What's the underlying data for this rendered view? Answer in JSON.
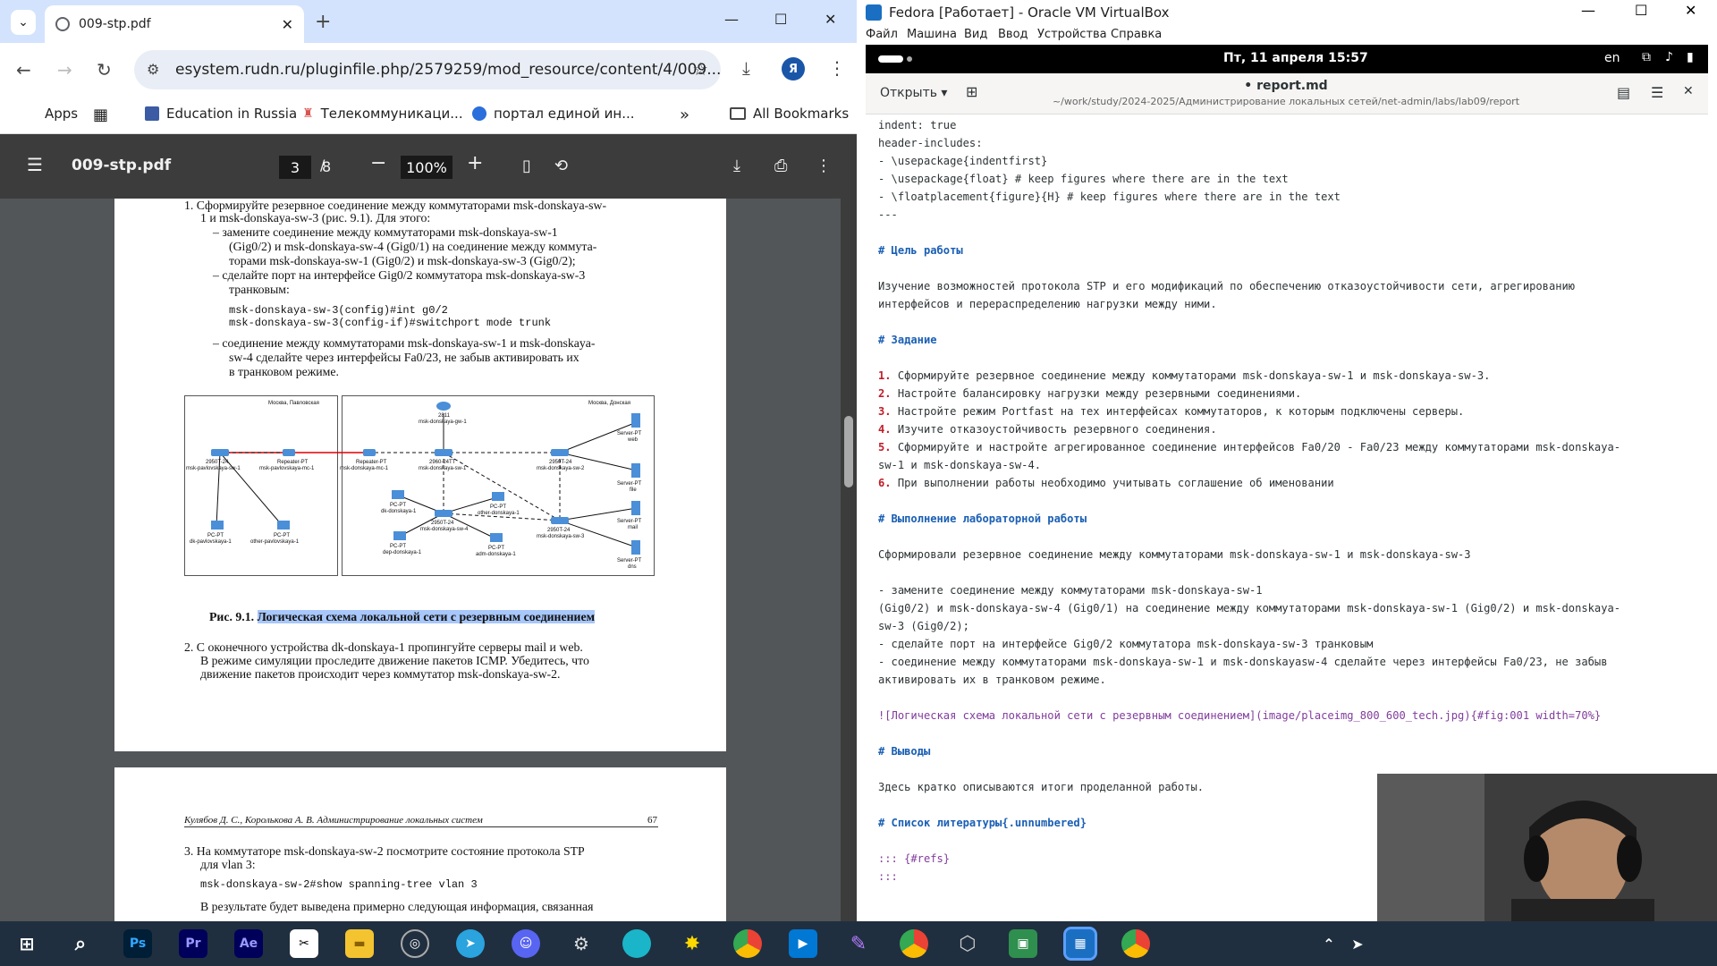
{
  "chrome": {
    "tab_title": "009-stp.pdf",
    "url": "esystem.rudn.ru/pluginfile.php/2579259/mod_resource/content/4/009...",
    "avatar_letter": "Я",
    "bookmarks": [
      "Apps",
      "Education in Russia",
      "Телекоммуникаци...",
      "портал единой ин..."
    ],
    "all_bookmarks": "All Bookmarks",
    "pdf": {
      "filename": "009-stp.pdf",
      "page_current": "3",
      "page_sep": "/",
      "page_total": "8",
      "zoom": "100%"
    }
  },
  "page1": {
    "lines": [
      "1.  Сформируйте резервное соединение между коммутаторами msk-donskaya-sw-",
      "1 и msk-donskaya-sw-3 (рис. 9.1). Для этого:",
      "–  замените соединение между коммутаторами msk-donskaya-sw-1",
      "(Gig0/2) и msk-donskaya-sw-4 (Gig0/1) на соединение между коммута-",
      "торами msk-donskaya-sw-1 (Gig0/2) и msk-donskaya-sw-3 (Gig0/2);",
      "–  сделайте порт на интерфейсе Gig0/2 коммутатора msk-donskaya-sw-3",
      "транковым:",
      "msk-donskaya-sw-3(config)#int g0/2",
      "msk-donskaya-sw-3(config-if)#switchport mode trunk",
      "–  соединение между коммутаторами msk-donskaya-sw-1 и msk-donskaya-",
      "sw-4 сделайте через интерфейсы Fa0/23, не забыв активировать их",
      "в транковом режиме."
    ],
    "fig_prefix": "Рис. 9.1.",
    "fig_caption": "Логическая схема локальной сети с резервным соединением",
    "item2": [
      "2.  С оконечного устройства dk-donskaya-1 пропингуйте серверы mail и web.",
      "В режиме симуляции проследите движение пакетов ICMP. Убедитесь, что",
      "движение пакетов происходит через коммутатор msk-donskaya-sw-2."
    ],
    "diagram": {
      "left_title": "Москва, Павловская",
      "right_title": "Москва, Донская",
      "labels": [
        "2950T-24",
        "msk-pavlovskaya-sw-1",
        "Repeater-PT",
        "msk-pavlovskaya-mc-1",
        "Repeater-PT",
        "msk-donskaya-mc-1",
        "2960-24TT",
        "msk-donskaya-sw-1",
        "2811",
        "msk-donskaya-gw-1",
        "2950T-24",
        "msk-donskaya-sw-2",
        "Server-PT",
        "web",
        "Server-PT",
        "file",
        "Server-PT",
        "mail",
        "Server-PT",
        "dns",
        "PC-PT",
        "dk-donskaya-1",
        "PC-PT",
        "other-donskaya-1",
        "2950T-24",
        "msk-donskaya-sw-4",
        "2950T-24",
        "msk-donskaya-sw-3",
        "PC-PT",
        "dep-donskaya-1",
        "PC-PT",
        "adm-donskaya-1",
        "PC-PT",
        "dk-pavlovskaya-1",
        "PC-PT",
        "other-pavlovskaya-1"
      ]
    }
  },
  "page2": {
    "header_left": "Кулябов Д. С., Королькова А. В. Администрирование локальных систем",
    "header_right": "67",
    "item3": [
      "3.  На коммутаторе msk-donskaya-sw-2 посмотрите состояние протокола STP",
      "для vlan 3:"
    ],
    "cmd": "msk-donskaya-sw-2#show spanning-tree vlan 3",
    "after": "В результате будет выведена примерно следующая информация, связанная"
  },
  "vbox": {
    "title": "Fedora [Работает] - Oracle VM VirtualBox",
    "menu": [
      "Файл",
      "Машина",
      "Вид",
      "Ввод",
      "Устройства",
      "Справка"
    ],
    "clock": "Пт, 11 апреля  15:57",
    "lang": "en",
    "open_label": "Открыть",
    "doc_title": "• report.md",
    "doc_path": "~/work/study/2024-2025/Администрирование локальных сетей/net-admin/labs/lab09/report"
  },
  "editor": {
    "lines": [
      "indent: true",
      "header-includes:",
      "  - \\usepackage{indentfirst}",
      "  - \\usepackage{float} # keep figures where there are in the text",
      "  - \\floatplacement{figure}{H} # keep figures where there are in the text",
      "---",
      "",
      "# Цель работы",
      "",
      "Изучение возможностей протокола STP и его модификаций по обеспечению отказоустойчивости сети, агрегированию",
      "интерфейсов и перераспределению нагрузки между ними.",
      "",
      "# Задание",
      "",
      "1. Сформируйте резервное соединение между коммутаторами msk-donskaya-sw-1 и msk-donskaya-sw-3.",
      "2. Настройте балансировку нагрузки между резервными соединениями.",
      "3. Настройте режим Portfast на тех интерфейсах коммутаторов, к которым подключены серверы.",
      "4. Изучите отказоустойчивость резервного соединения.",
      "5. Сформируйте и настройте агрегированное соединение интерфейсов Fa0/20 - Fa0/23 между коммутаторами msk-donskaya-",
      "sw-1 и msk-donskaya-sw-4.",
      "6. При выполнении работы необходимо учитывать соглашение об именовании",
      "",
      "# Выполнение лабораторной работы",
      "",
      "Сформировали резервное соединение между коммутаторами msk-donskaya-sw-1 и msk-donskaya-sw-3",
      "",
      "- замените соединение между коммутаторами msk-donskaya-sw-1",
      "(Gig0/2) и msk-donskaya-sw-4 (Gig0/1) на соединение между коммутаторами msk-donskaya-sw-1 (Gig0/2) и msk-donskaya-",
      "sw-3 (Gig0/2);",
      "- сделайте порт на интерфейсе Gig0/2 коммутатора msk-donskaya-sw-3 транковым",
      "- соединение между коммутаторами msk-donskaya-sw-1 и msk-donskayasw-4 сделайте через интерфейсы Fa0/23, не забыв",
      "активировать их в транковом режиме.",
      "",
      "![Логическая схема локальной сети с резервным соединением](image/placeimg_800_600_tech.jpg){#fig:001 width=70%}",
      "",
      "# Выводы",
      "",
      "Здесь кратко описываются итоги проделанной работы.",
      "",
      "# Список литературы{.unnumbered}",
      "",
      "::: {#refs}",
      ":::"
    ]
  },
  "taskbar": {
    "apps": [
      "Ps",
      "Pr",
      "Ae"
    ]
  }
}
